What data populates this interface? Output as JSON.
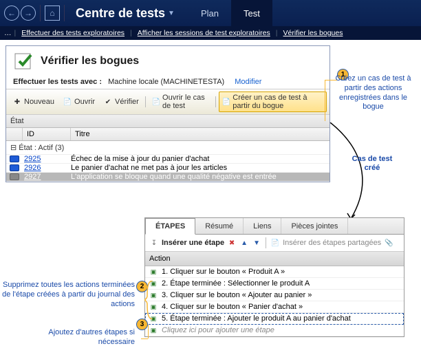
{
  "nav": {
    "title": "Centre de tests",
    "tabs": {
      "plan": "Plan",
      "test": "Test"
    }
  },
  "breadcrumbs": {
    "c1": "Effectuer des tests exploratoires",
    "c2": "Afficher les sessions de test exploratoires",
    "c3": "Vérifier les bogues"
  },
  "panel": {
    "title": "Vérifier les bogues",
    "meta_label": "Effectuer les tests avec :",
    "meta_value": "Machine locale (MACHINETESTA)",
    "modify": "Modifier"
  },
  "toolbar": {
    "new": "Nouveau",
    "open": "Ouvrir",
    "verify": "Vérifier",
    "open_test": "Ouvrir le cas de test",
    "create_from_bug": "Créer un cas de test à partir du bogue"
  },
  "state": {
    "label": "État"
  },
  "cols": {
    "id": "ID",
    "title": "Titre"
  },
  "group": {
    "label": "État : Actif (3)"
  },
  "rows": [
    {
      "id": "2925",
      "title": "Échec de la mise à jour du panier d'achat"
    },
    {
      "id": "2926",
      "title": "Le panier d'achat ne met pas à jour les articles"
    },
    {
      "id": "2927",
      "title": "L'application se bloque quand une qualité négative est entrée"
    }
  ],
  "callouts": {
    "c1": "Créez un cas de test à partir des actions enregistrées dans le bogue",
    "created": "Cas de test créé",
    "c2": "Supprimez toutes les actions terminées de l'étape créées à partir du journal des actions",
    "c3": "Ajoutez d'autres étapes si nécessaire"
  },
  "steps_panel": {
    "tabs": {
      "steps": "ÉTAPES",
      "summary": "Résumé",
      "links": "Liens",
      "attach": "Pièces jointes"
    },
    "insert": "Insérer une étape",
    "shared": "Insérer des étapes partagées",
    "action_head": "Action",
    "steps": [
      "1. Cliquer sur le bouton « Produit A »",
      "2. Étape terminée : Sélectionner le produit A",
      "3. Cliquer sur le bouton « Ajouter au panier »",
      "4. Cliquer sur le bouton « Panier d'achat »",
      "5. Étape terminée : Ajouter le produit A au panier d'achat"
    ],
    "hint": "Cliquez ici pour ajouter une étape"
  }
}
